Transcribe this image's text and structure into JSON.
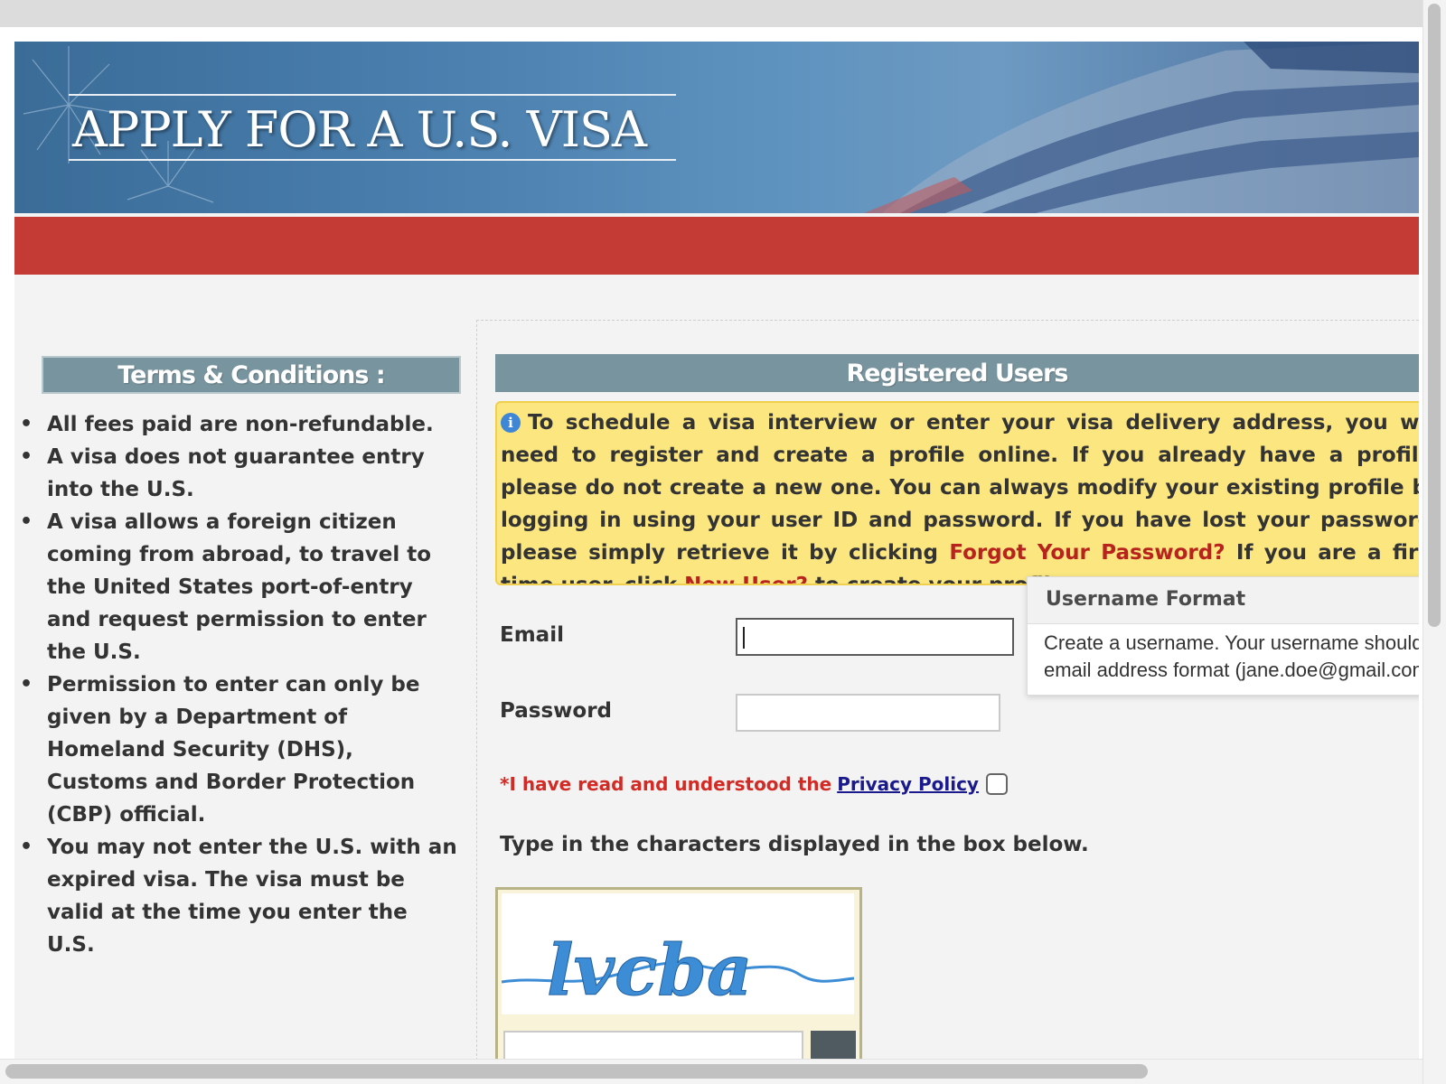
{
  "banner": {
    "title": "APPLY FOR A U.S. VISA"
  },
  "terms": {
    "heading": "Terms & Conditions :",
    "items": [
      "All fees paid are non-refundable.",
      "A visa does not guarantee entry into the U.S.",
      "A visa allows a foreign citizen coming from abroad, to travel to the United States port-of-entry and request permission to enter the U.S.",
      "Permission to enter can only be given by a Department of Homeland Security (DHS), Customs and Border Protection (CBP) official.",
      "You may not enter the U.S. with an expired visa. The visa must be valid at the time you enter the U.S."
    ]
  },
  "registered": {
    "heading": "Registered Users",
    "info_icon": "i",
    "info_text_1": "To schedule a visa interview or enter your visa delivery address, you will need to register and create a profile online. If you already have a profile, please do not create a new one. You can always modify your existing profile by logging in using your user ID and password. If you have lost your password, please simply retrieve it by clicking",
    "forgot_link": "Forgot Your Password?",
    "info_text_2": "If you are a first time user, click",
    "new_user_link": "New User?",
    "info_text_3": "to create your profile."
  },
  "form": {
    "email_label": "Email",
    "email_value": "",
    "password_label": "Password",
    "password_value": "",
    "privacy_text": "*I have read and understood the",
    "privacy_link": "Privacy Policy",
    "privacy_checked": false,
    "captcha_instruction": "Type in the characters displayed in the box below.",
    "captcha_text": "lvcba"
  },
  "tooltip": {
    "title": "Username Format",
    "body_line_1": "Create a username. Your username should be in",
    "body_line_2": "email address format (jane.doe@gmail.com)."
  },
  "colors": {
    "accent_red": "#c43b36",
    "panel_head": "#78949e",
    "info_yellow": "#fbe67f",
    "link_red": "#b8231e",
    "link_blue": "#1a1a8c"
  }
}
